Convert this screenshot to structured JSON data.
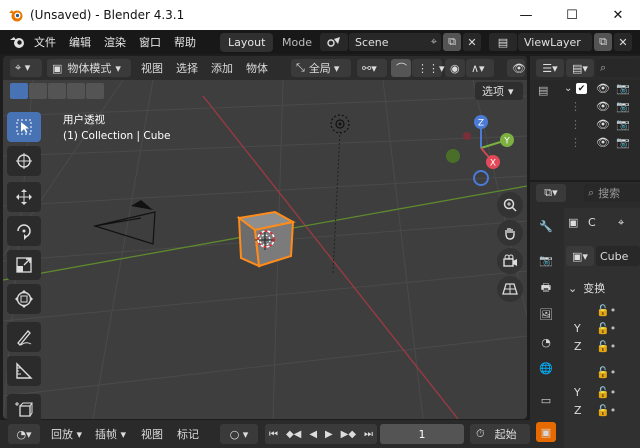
{
  "window": {
    "title": "(Unsaved) - Blender 4.3.1",
    "minimize": "—",
    "maximize": "☐",
    "close": "✕"
  },
  "menu": {
    "items": [
      "文件",
      "编辑",
      "渲染",
      "窗口",
      "帮助"
    ]
  },
  "workspaces": {
    "active": "Layout",
    "next": "Mode"
  },
  "scene": {
    "name": "Scene",
    "view_layer": "ViewLayer"
  },
  "viewport_header": {
    "mode": "物体模式",
    "view": "视图",
    "select": "选择",
    "add": "添加",
    "object": "物体",
    "orientation": "全局",
    "options": "选项"
  },
  "viewport": {
    "view_name": "用户透视",
    "collection_info": "(1) Collection | Cube",
    "gizmo": {
      "x": "X",
      "y": "Y",
      "z": "Z"
    }
  },
  "timeline": {
    "playback": "回放",
    "keying": "插帧",
    "view": "视图",
    "marker": "标记",
    "current_frame": "1",
    "start_label": "起始"
  },
  "outliner": {
    "search_placeholder": "搜索",
    "visible_rows": 4
  },
  "properties": {
    "object_name_short": "C",
    "object_name": "Cube",
    "transform_label": "变换",
    "axes": [
      "Y",
      "Z",
      "Y",
      "Z"
    ]
  },
  "colors": {
    "accent_blue": "#4772b3",
    "selection_orange": "#ff8c1a",
    "x_axis": "#c94a55",
    "y_axis": "#7cb041",
    "z_axis": "#4a7bd6"
  }
}
